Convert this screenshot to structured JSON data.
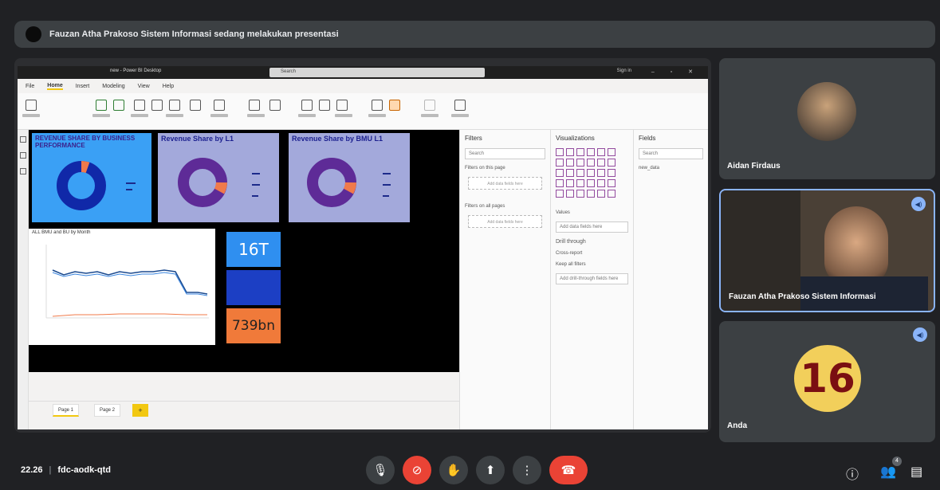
{
  "banner": {
    "text": "Fauzan Atha Prakoso Sistem Informasi sedang melakukan presentasi"
  },
  "pbi": {
    "title": "new - Power BI Desktop",
    "search": "Search",
    "user": "Sign in",
    "window_controls": "– ▫ ✕",
    "menu": [
      "File",
      "Home",
      "Insert",
      "Modeling",
      "View",
      "Help"
    ],
    "active_menu": "Home",
    "cards": {
      "bu_title": "REVENUE SHARE BY BUSINESS PERFORMANCE",
      "l1_title": "Revenue Share by L1",
      "bmu_title": "Revenue Share by BMU L1"
    },
    "line_title": "ALL BMU and BU by Month",
    "kpis": [
      "16T",
      "739bn"
    ],
    "page_tabs": [
      "Page 1",
      "Page 2"
    ],
    "page_add": "+",
    "filters": {
      "header": "Filters",
      "search": "Search",
      "this_page": "Filters on this page",
      "add_here": "Add data fields here",
      "all_pages": "Filters on all pages",
      "add_here2": "Add data fields here"
    },
    "viz": {
      "header": "Visualizations",
      "values_label": "Values",
      "values_drop": "Add data fields here",
      "drill": "Drill through",
      "cross_report": "Cross-report",
      "keep_filters": "Keep all filters",
      "drill_drop": "Add drill-through fields here"
    },
    "fields": {
      "header": "Fields",
      "search": "Search",
      "item": "new_data"
    }
  },
  "participants": [
    {
      "name": "Aidan Firdaus"
    },
    {
      "name": "Fauzan Atha Prakoso Sistem Informasi"
    },
    {
      "name": "Anda",
      "avatar_text": "16"
    }
  ],
  "bottom": {
    "time": "22.26",
    "separator": "|",
    "meeting_code": "fdc-aodk-qtd",
    "participant_count": "4"
  },
  "colors": {
    "bg": "#202124",
    "red": "#ea4335",
    "accent": "#8ab4f8",
    "pbi_yellow": "#f2c811"
  }
}
